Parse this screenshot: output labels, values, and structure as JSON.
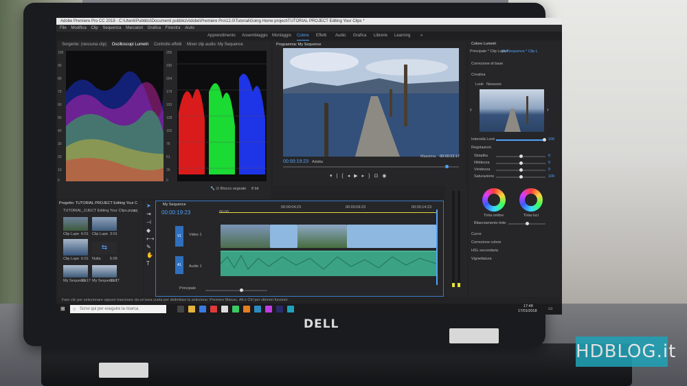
{
  "window": {
    "title": "Adobe Premiere Pro CC 2018 - C:\\Utenti\\Pubblici\\Documenti pubblici\\Adobe\\Premiere Pro\\12.0\\Tutorial\\Going Home project\\TUTORIAL PROJECT Editing Your Clips *"
  },
  "menu": [
    "File",
    "Modifica",
    "Clip",
    "Sequenza",
    "Marcatori",
    "Grafica",
    "Finestra",
    "Aiuto"
  ],
  "workspaces": {
    "items": [
      "Apprendimento",
      "Assemblaggio",
      "Montaggio",
      "Colore",
      "Effetti",
      "Audio",
      "Grafica",
      "Librerie",
      "Learning"
    ],
    "active": "Colore"
  },
  "scopes_panel": {
    "tabs": [
      "Sorgente: (nessuna clip)",
      "Oscilloscopi Lumetri",
      "Controllo effetti",
      "Mixer clip audio: My Sequence"
    ],
    "ticks_left": [
      "100",
      "90",
      "80",
      "70",
      "60",
      "50",
      "40",
      "30",
      "20",
      "10",
      "0"
    ],
    "ticks_mid": [
      "255",
      "230",
      "204",
      "179",
      "153",
      "128",
      "102",
      "76",
      "51",
      "26",
      "0"
    ],
    "footer_clamp": "Blocco segnale",
    "footer_bit": "8 bit"
  },
  "program_monitor": {
    "title": "Programma: My Sequence",
    "timecode_left": "00:00:19:23",
    "fit": "Adatta",
    "quality": "Massima",
    "timecode_right": "00:00:22:17"
  },
  "project_panel": {
    "title": "Progetto: TUTORIAL PROJECT Editing Your C",
    "file": "TUTORIAL_OJECT Editing Your Clips.prproj",
    "items": [
      {
        "name": "Clip Lupe",
        "duration": "6:01"
      },
      {
        "name": "Clip Lupe",
        "duration": "3:01"
      },
      {
        "name": "Clip Lupe",
        "duration": "6:01"
      },
      {
        "name": "Nulla",
        "duration": "5:09"
      },
      {
        "name": "Clip Lupe",
        "duration": "3:01"
      },
      {
        "name": "Clip Lupe",
        "duration": "2:01"
      },
      {
        "name": "My Sequence",
        "duration": "22:17"
      },
      {
        "name": "My Sequence2",
        "duration": "22:17"
      }
    ]
  },
  "timeline": {
    "tab": "My Sequence",
    "timecode": "00:00:19:23",
    "ruler": [
      "00:00",
      "00:00:04:23",
      "00:00:09:23",
      "00:00:14:23"
    ],
    "tracks": [
      {
        "id": "V1",
        "name": "Video 1"
      },
      {
        "id": "A1",
        "name": "Audio 1"
      }
    ],
    "footer": "Principale"
  },
  "lumetri": {
    "title": "Colore Lumetri",
    "master": "Principale * Clip Lupe4",
    "sequence": "My Sequence * Clip L",
    "sections": [
      "Correzione di base",
      "Creativa"
    ],
    "look_label": "Look",
    "look_value": "Nessuno",
    "intensity_label": "Intensità Look",
    "intensity": 100,
    "adjustments_title": "Regolazioni",
    "sliders": [
      {
        "label": "Sbiadita",
        "value": 0.0
      },
      {
        "label": "Nitidezza",
        "value": 0.0
      },
      {
        "label": "Vividezza",
        "value": 0.0
      },
      {
        "label": "Saturazione",
        "value": 100.0
      }
    ],
    "wheel_labels": [
      "Tinta ombre",
      "Tinta luci"
    ],
    "balance_label": "Bilanciamento tinte",
    "more_sections": [
      "Curve",
      "Correzione colore",
      "HSL secondaria",
      "Vignettatura"
    ]
  },
  "statusbar": "Fare clic per selezionare oppure trascinare da un'area vuota per delimitare la selezione. Premere Maiusc, Alt e Ctrl per ulteriori funzioni.",
  "taskbar": {
    "search_placeholder": "Scrivi qui per eseguire la ricerca",
    "time": "17:48",
    "date": "17/01/2018"
  },
  "brand": {
    "laptop": "DELL",
    "watermark": "HDBLOG.it"
  },
  "colors": {
    "accent": "#4fa3ff",
    "audio_clip": "#3ba383",
    "watermark": "#1fa3b8"
  }
}
